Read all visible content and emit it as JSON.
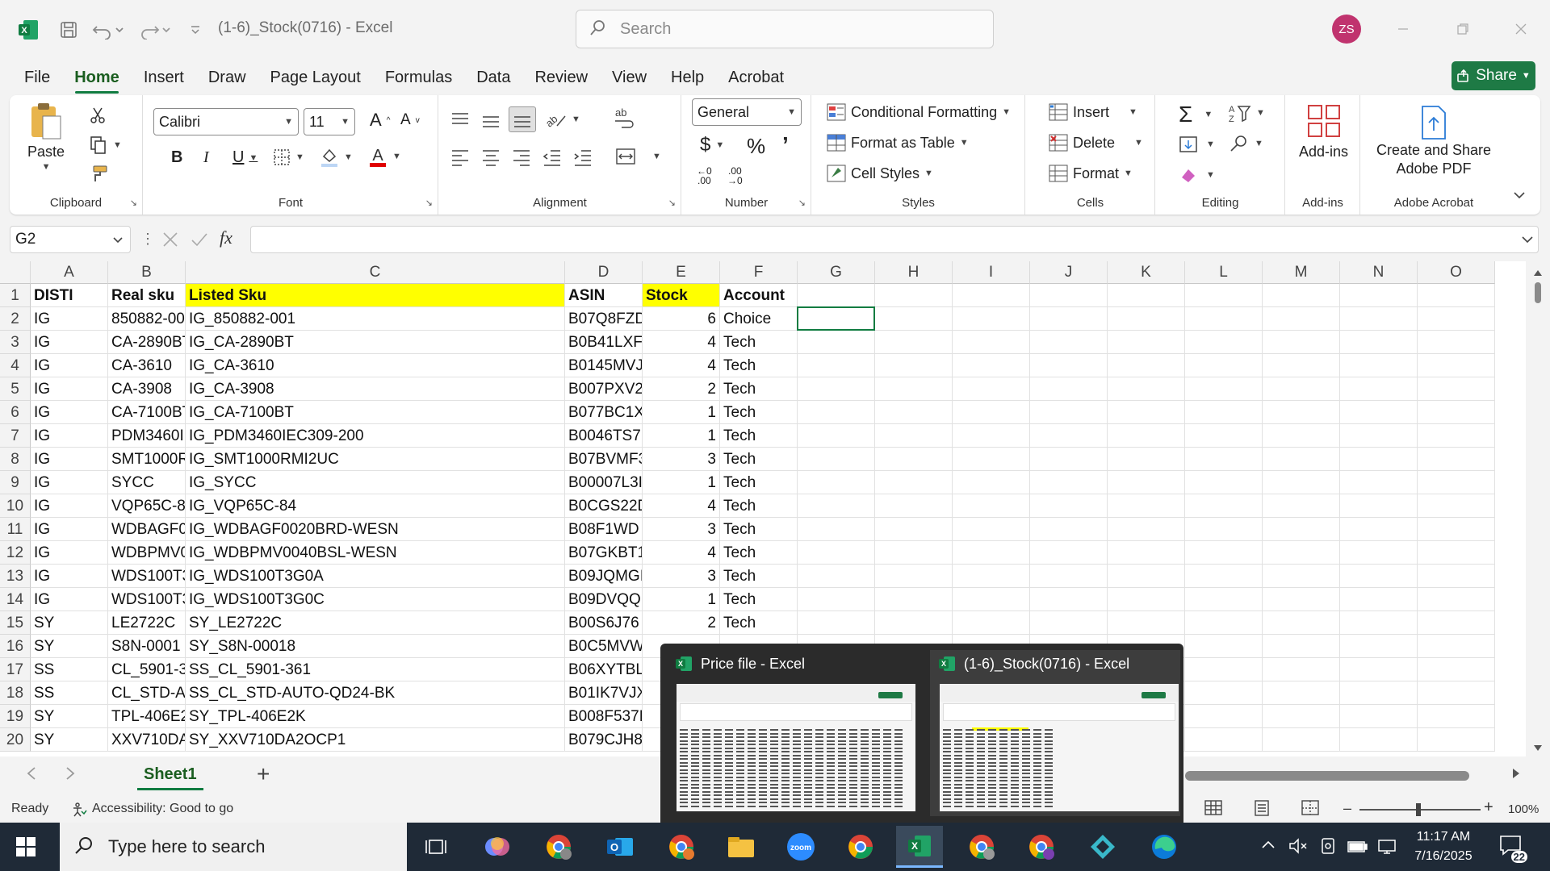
{
  "title_bar": {
    "doc_title": "(1-6)_Stock(0716)  -  Excel",
    "search_placeholder": "Search",
    "avatar_initials": "ZS"
  },
  "tabs": [
    "File",
    "Home",
    "Insert",
    "Draw",
    "Page Layout",
    "Formulas",
    "Data",
    "Review",
    "View",
    "Help",
    "Acrobat"
  ],
  "active_tab": "Home",
  "share_label": "Share",
  "ribbon": {
    "clipboard": {
      "label": "Clipboard",
      "paste": "Paste"
    },
    "font": {
      "label": "Font",
      "family": "Calibri",
      "size": "11"
    },
    "alignment": {
      "label": "Alignment"
    },
    "number": {
      "label": "Number",
      "format": "General"
    },
    "styles": {
      "label": "Styles",
      "conditional": "Conditional Formatting",
      "format_table": "Format as Table",
      "cell_styles": "Cell Styles"
    },
    "cells": {
      "label": "Cells",
      "insert": "Insert",
      "delete": "Delete",
      "format": "Format"
    },
    "editing": {
      "label": "Editing"
    },
    "addins": {
      "label": "Add-ins",
      "button": "Add-ins"
    },
    "acrobat": {
      "label": "Adobe Acrobat",
      "create_line1": "Create and Share",
      "create_line2": "Adobe PDF"
    }
  },
  "formula_bar": {
    "name_box": "G2",
    "formula": ""
  },
  "columns": [
    "A",
    "B",
    "C",
    "D",
    "E",
    "F",
    "G",
    "H",
    "I",
    "J",
    "K",
    "L",
    "M",
    "N",
    "O"
  ],
  "rows": [
    [
      "DISTI",
      "Real sku",
      "Listed Sku",
      "ASIN",
      "Stock",
      "Account"
    ],
    [
      "IG",
      "850882-00",
      "IG_850882-001",
      "B07Q8FZD",
      "6",
      "Choice"
    ],
    [
      "IG",
      "CA-2890BT",
      "IG_CA-2890BT",
      "B0B41LXF",
      "4",
      "Tech"
    ],
    [
      "IG",
      "CA-3610",
      "IG_CA-3610",
      "B0145MVJ",
      "4",
      "Tech"
    ],
    [
      "IG",
      "CA-3908",
      "IG_CA-3908",
      "B007PXV2",
      "2",
      "Tech"
    ],
    [
      "IG",
      "CA-7100BT",
      "IG_CA-7100BT",
      "B077BC1X",
      "1",
      "Tech"
    ],
    [
      "IG",
      "PDM3460I",
      "IG_PDM3460IEC309-200",
      "B0046TS7",
      "1",
      "Tech"
    ],
    [
      "IG",
      "SMT1000R",
      "IG_SMT1000RMI2UC",
      "B07BVMF3",
      "3",
      "Tech"
    ],
    [
      "IG",
      "SYCC",
      "IG_SYCC",
      "B00007L3I",
      "1",
      "Tech"
    ],
    [
      "IG",
      "VQP65C-84",
      "IG_VQP65C-84",
      "B0CGS22D",
      "4",
      "Tech"
    ],
    [
      "IG",
      "WDBAGF0",
      "IG_WDBAGF0020BRD-WESN",
      "B08F1WD",
      "3",
      "Tech"
    ],
    [
      "IG",
      "WDBPMV0",
      "IG_WDBPMV0040BSL-WESN",
      "B07GKBT1",
      "4",
      "Tech"
    ],
    [
      "IG",
      "WDS100T3",
      "IG_WDS100T3G0A",
      "B09JQMGI",
      "3",
      "Tech"
    ],
    [
      "IG",
      "WDS100T3",
      "IG_WDS100T3G0C",
      "B09DVQQ",
      "1",
      "Tech"
    ],
    [
      "SY",
      "LE2722C",
      "SY_LE2722C",
      "B00S6J76",
      "2",
      "Tech"
    ],
    [
      "SY",
      "S8N-0001",
      "SY_S8N-00018",
      "B0C5MVW",
      "",
      ""
    ],
    [
      "SS",
      "CL_5901-3",
      "SS_CL_5901-361",
      "B06XYTBL",
      "",
      ""
    ],
    [
      "SS",
      "CL_STD-AU",
      "SS_CL_STD-AUTO-QD24-BK",
      "B01IK7VJX",
      "",
      ""
    ],
    [
      "SY",
      "TPL-406E2",
      "SY_TPL-406E2K",
      "B008F537I",
      "",
      ""
    ],
    [
      "SY",
      "XXV710DA",
      "SY_XXV710DA2OCP1",
      "B079CJH8",
      "",
      ""
    ]
  ],
  "sheet_tab": "Sheet1",
  "status": {
    "ready": "Ready",
    "accessibility": "Accessibility: Good to go",
    "zoom": "100%"
  },
  "taskbar": {
    "search_placeholder": "Type here to search",
    "time": "11:17 AM",
    "date": "7/16/2025",
    "notifications": "22"
  },
  "previews": [
    {
      "title": "Price file - Excel"
    },
    {
      "title": "(1-6)_Stock(0716) - Excel"
    }
  ],
  "colors": {
    "excel_green": "#107c41",
    "highlight_yellow": "#ffff00",
    "avatar": "#c0336e",
    "taskbar": "#1f2a37"
  }
}
